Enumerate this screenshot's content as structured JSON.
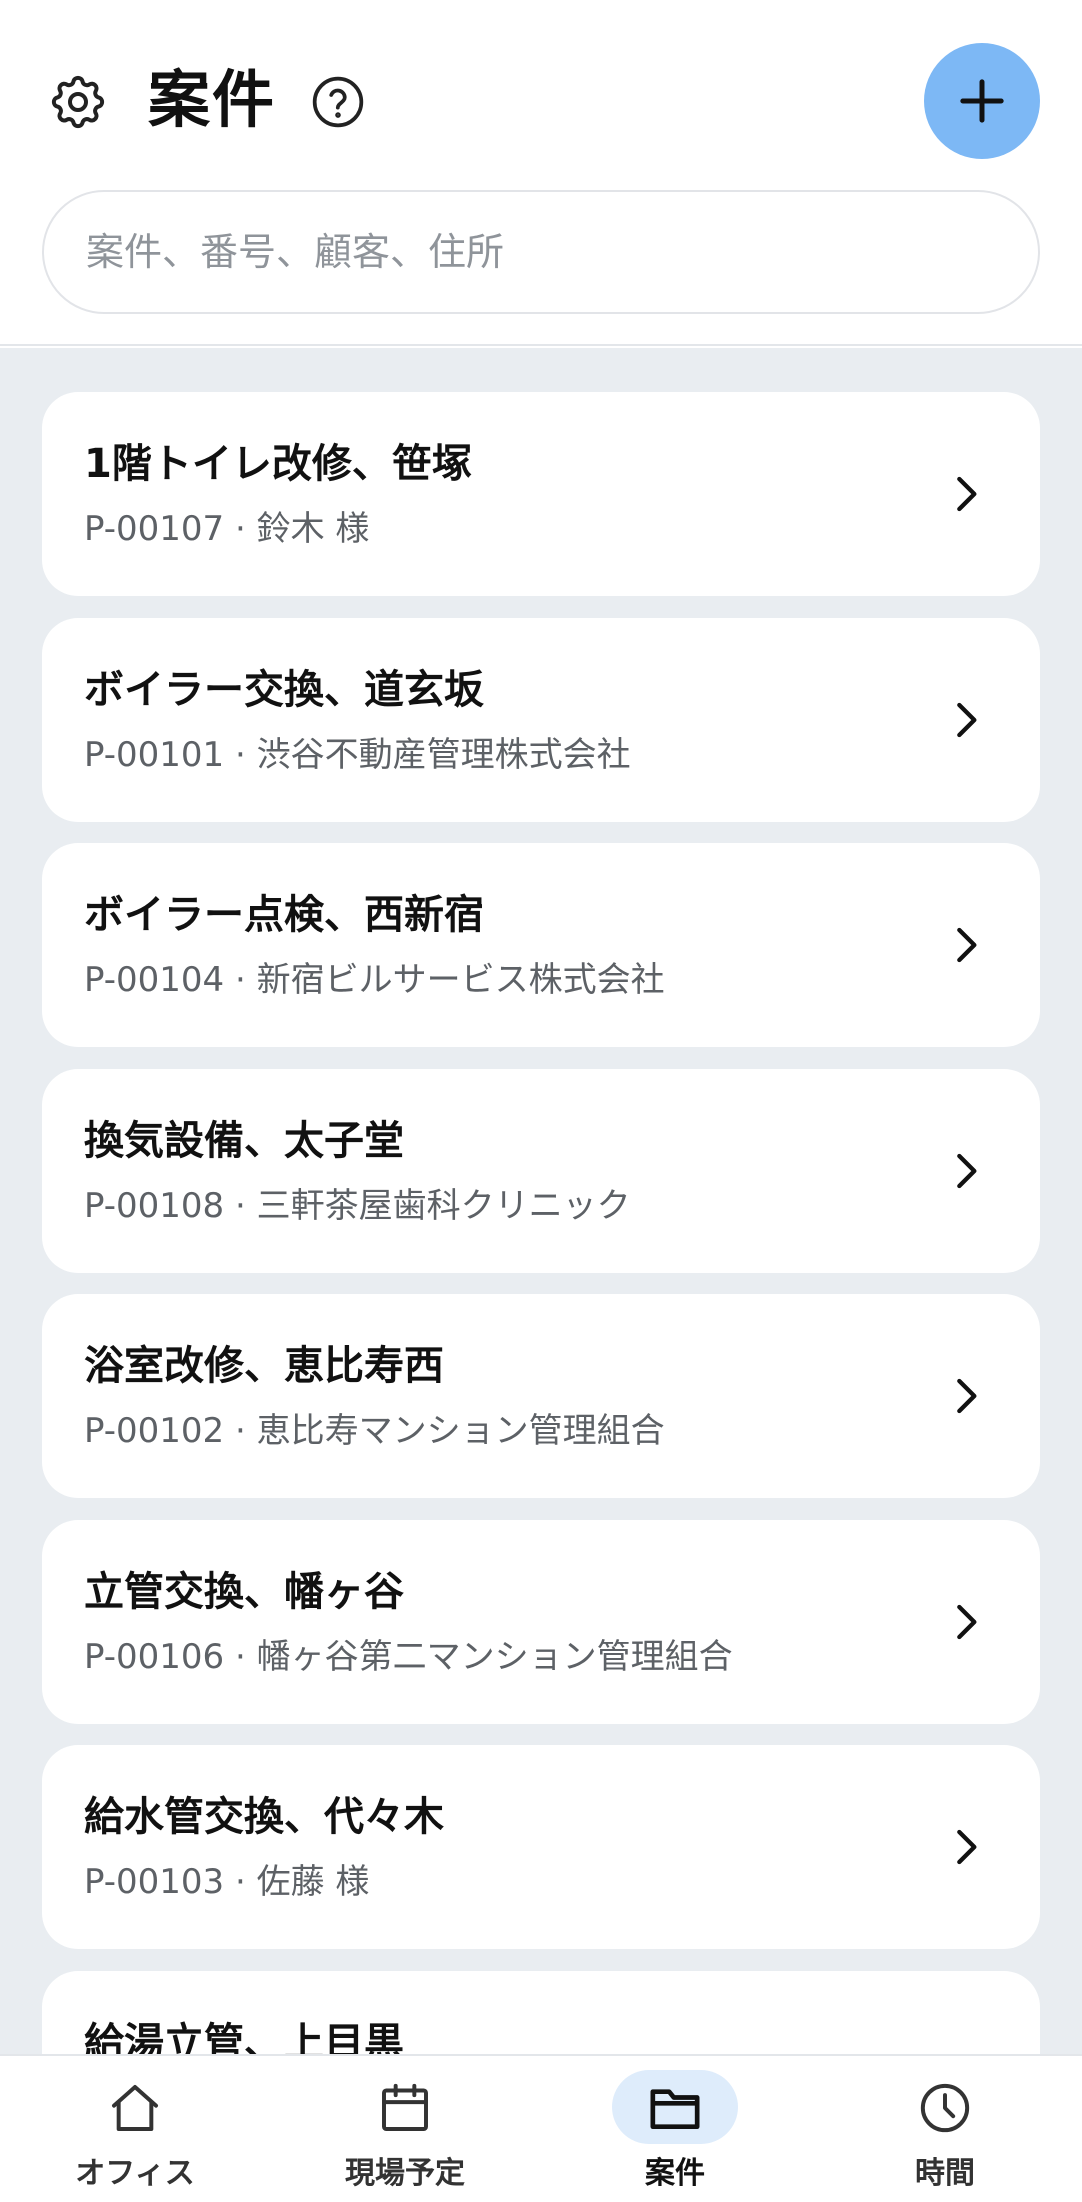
{
  "header": {
    "title": "案件",
    "settings_icon": "gear-icon",
    "help_icon": "question-circle-icon",
    "add_icon": "plus-icon"
  },
  "search": {
    "placeholder": "案件、番号、顧客、住所",
    "value": ""
  },
  "projects": [
    {
      "title": "1階トイレ改修、笹塚",
      "subtitle": "P-00107 · 鈴木 様"
    },
    {
      "title": "ボイラー交換、道玄坂",
      "subtitle": "P-00101 · 渋谷不動産管理株式会社"
    },
    {
      "title": "ボイラー点検、西新宿",
      "subtitle": "P-00104 · 新宿ビルサービス株式会社"
    },
    {
      "title": "換気設備、太子堂",
      "subtitle": "P-00108 · 三軒茶屋歯科クリニック"
    },
    {
      "title": "浴室改修、恵比寿西",
      "subtitle": "P-00102 · 恵比寿マンション管理組合"
    },
    {
      "title": "立管交換、幡ヶ谷",
      "subtitle": "P-00106 · 幡ヶ谷第二マンション管理組合"
    },
    {
      "title": "給水管交換、代々木",
      "subtitle": "P-00103 · 佐藤 様"
    },
    {
      "title": "給湯立管、上目黒",
      "subtitle": ""
    }
  ],
  "nav": [
    {
      "label": "オフィス",
      "icon": "home-icon",
      "active": false
    },
    {
      "label": "現場予定",
      "icon": "calendar-icon",
      "active": false
    },
    {
      "label": "案件",
      "icon": "folder-icon",
      "active": true
    },
    {
      "label": "時間",
      "icon": "clock-icon",
      "active": false
    }
  ],
  "colors": {
    "accent": "#7db8f5",
    "active_pill": "#deecfb",
    "list_background": "#e9edf1"
  }
}
